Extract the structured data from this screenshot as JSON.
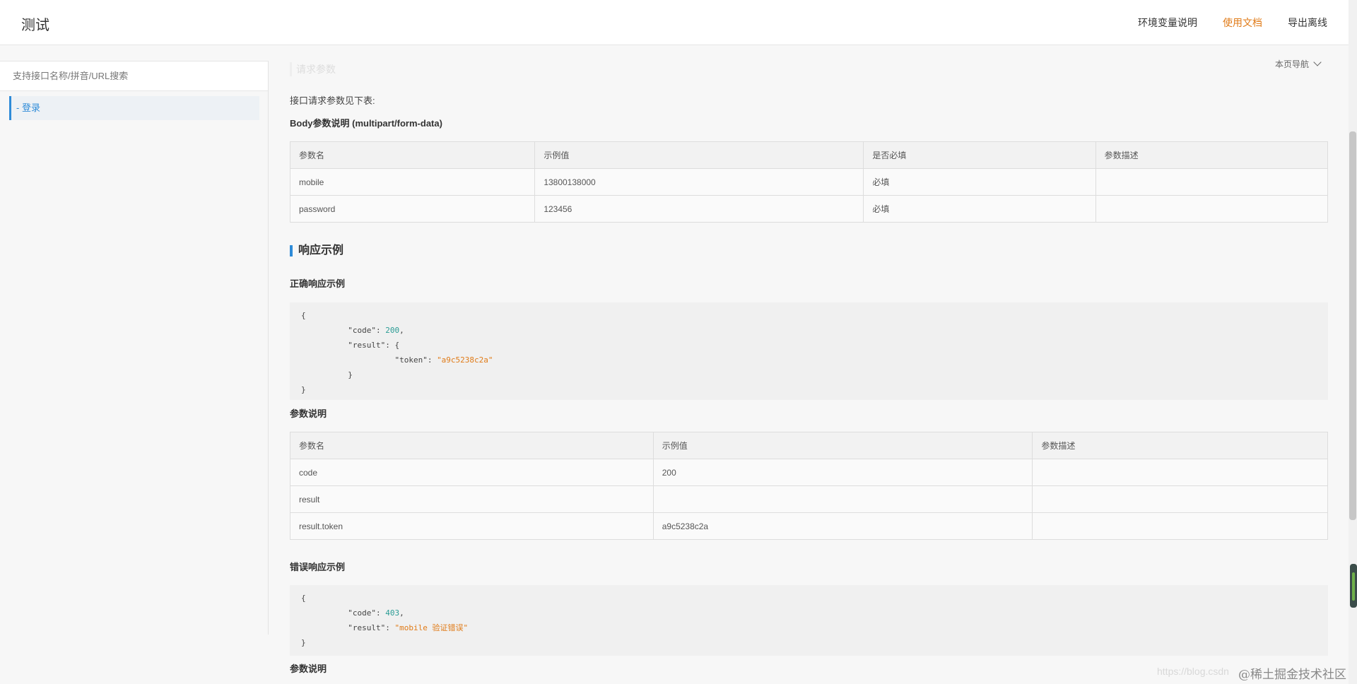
{
  "header": {
    "title": "测试",
    "nav": [
      "环境变量说明",
      "使用文档",
      "导出离线"
    ],
    "active_nav": "使用文档"
  },
  "sidebar": {
    "search_placeholder": "支持接口名称/拼音/URL搜索",
    "items": [
      {
        "label": "- 登录"
      }
    ]
  },
  "main": {
    "faded_heading": "请求参数",
    "page_nav": "本页导航",
    "intro": "接口请求参数见下表:",
    "body_params_title": "Body参数说明 (multipart/form-data)",
    "body_table": {
      "headers": [
        "参数名",
        "示例值",
        "是否必填",
        "参数描述"
      ],
      "rows": [
        [
          "mobile",
          "13800138000",
          "必填",
          ""
        ],
        [
          "password",
          "123456",
          "必填",
          ""
        ]
      ]
    },
    "response_section_title": "响应示例",
    "success_title": "正确响应示例",
    "success_code": {
      "open": "{",
      "code_key": "\"code\"",
      "code_value": "200",
      "result_key": "\"result\"",
      "token_key": "\"token\"",
      "token_value": "\"a9c5238c2a\"",
      "inner_close": "}",
      "close": "}"
    },
    "params_title": "参数说明",
    "response_table": {
      "headers": [
        "参数名",
        "示例值",
        "参数描述"
      ],
      "rows": [
        [
          "code",
          "200",
          ""
        ],
        [
          "result",
          "",
          ""
        ],
        [
          "result.token",
          "a9c5238c2a",
          ""
        ]
      ]
    },
    "error_title": "错误响应示例",
    "error_code": {
      "open": "{",
      "code_key": "\"code\"",
      "code_value": "403",
      "result_key": "\"result\"",
      "result_value": "\"mobile 验证错误\"",
      "close": "}"
    },
    "params_title_2": "参数说明"
  },
  "watermark": {
    "faded": "https://blog.csdn",
    "text": "@稀土掘金技术社区"
  }
}
